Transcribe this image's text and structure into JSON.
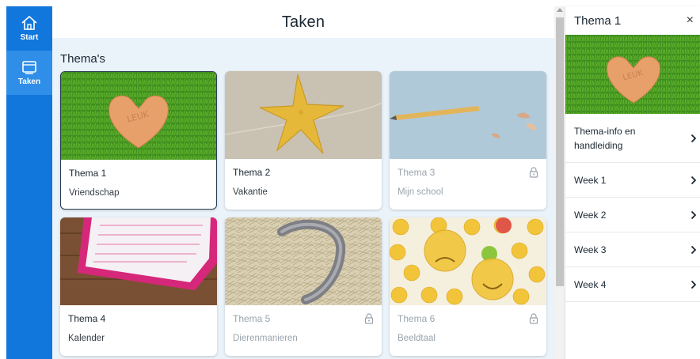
{
  "nav": {
    "items": [
      {
        "label": "Start",
        "icon": "home-icon"
      },
      {
        "label": "Taken",
        "icon": "window-icon"
      }
    ]
  },
  "main": {
    "title": "Taken",
    "section_title": "Thema's",
    "cards": [
      {
        "title": "Thema 1",
        "subtitle": "Vriendschap",
        "locked": false,
        "image": "heart-on-grass"
      },
      {
        "title": "Thema 2",
        "subtitle": "Vakantie",
        "locked": false,
        "image": "starfish-on-sand"
      },
      {
        "title": "Thema 3",
        "subtitle": "Mijn school",
        "locked": true,
        "image": "pencil-shavings"
      },
      {
        "title": "Thema 4",
        "subtitle": "Kalender",
        "locked": false,
        "image": "calendar-on-wood"
      },
      {
        "title": "Thema 5",
        "subtitle": "Dierenmanieren",
        "locked": true,
        "image": "horseshoe-on-straw"
      },
      {
        "title": "Thema 6",
        "subtitle": "Beeldtaal",
        "locked": true,
        "image": "emoji-faces"
      }
    ]
  },
  "panel": {
    "title": "Thema 1",
    "close_label": "×",
    "items": [
      {
        "label": "Thema-info en handleiding"
      },
      {
        "label": "Week 1"
      },
      {
        "label": "Week 2"
      },
      {
        "label": "Week 3"
      },
      {
        "label": "Week 4"
      }
    ]
  },
  "colors": {
    "nav_bg": "#1177dd",
    "main_bg": "#eaf2fa",
    "text": "#1a2733",
    "locked_text": "#9aa4ad"
  }
}
